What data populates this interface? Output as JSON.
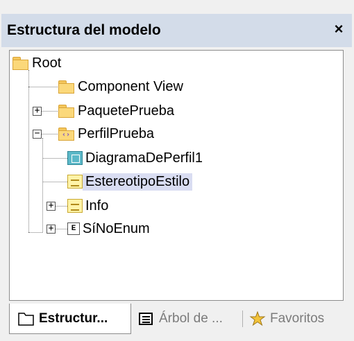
{
  "window": {
    "title": "Estructura del modelo",
    "close_symbol": "×"
  },
  "tree": {
    "nodes": [
      {
        "label": "Root",
        "icon": "folder-icon"
      },
      {
        "label": "Component View",
        "icon": "folder-icon"
      },
      {
        "label": "PaquetePrueba",
        "icon": "folder-icon",
        "expander": "+"
      },
      {
        "label": "PerfilPrueba",
        "icon": "profile-folder-icon",
        "expander": "−"
      },
      {
        "label": "DiagramaDePerfil1",
        "icon": "profile-diagram-icon"
      },
      {
        "label": "EstereotipoEstilo",
        "icon": "stereotype-icon",
        "selected": true
      },
      {
        "label": "Info",
        "icon": "stereotype-icon",
        "expander": "+"
      },
      {
        "label": "SíNoEnum",
        "icon": "enumeration-icon",
        "expander": "+",
        "icon_letter": "E"
      }
    ]
  },
  "tabs": [
    {
      "label": "Estructur...",
      "icon": "folder-outline-icon",
      "active": true
    },
    {
      "label": "Árbol de ...",
      "icon": "list-icon",
      "active": false
    },
    {
      "label": "Favoritos",
      "icon": "star-icon",
      "active": false
    }
  ],
  "colors": {
    "titlebar": "#d3dce9",
    "selection": "#d9ddf2",
    "folder": "#fbd87a"
  }
}
